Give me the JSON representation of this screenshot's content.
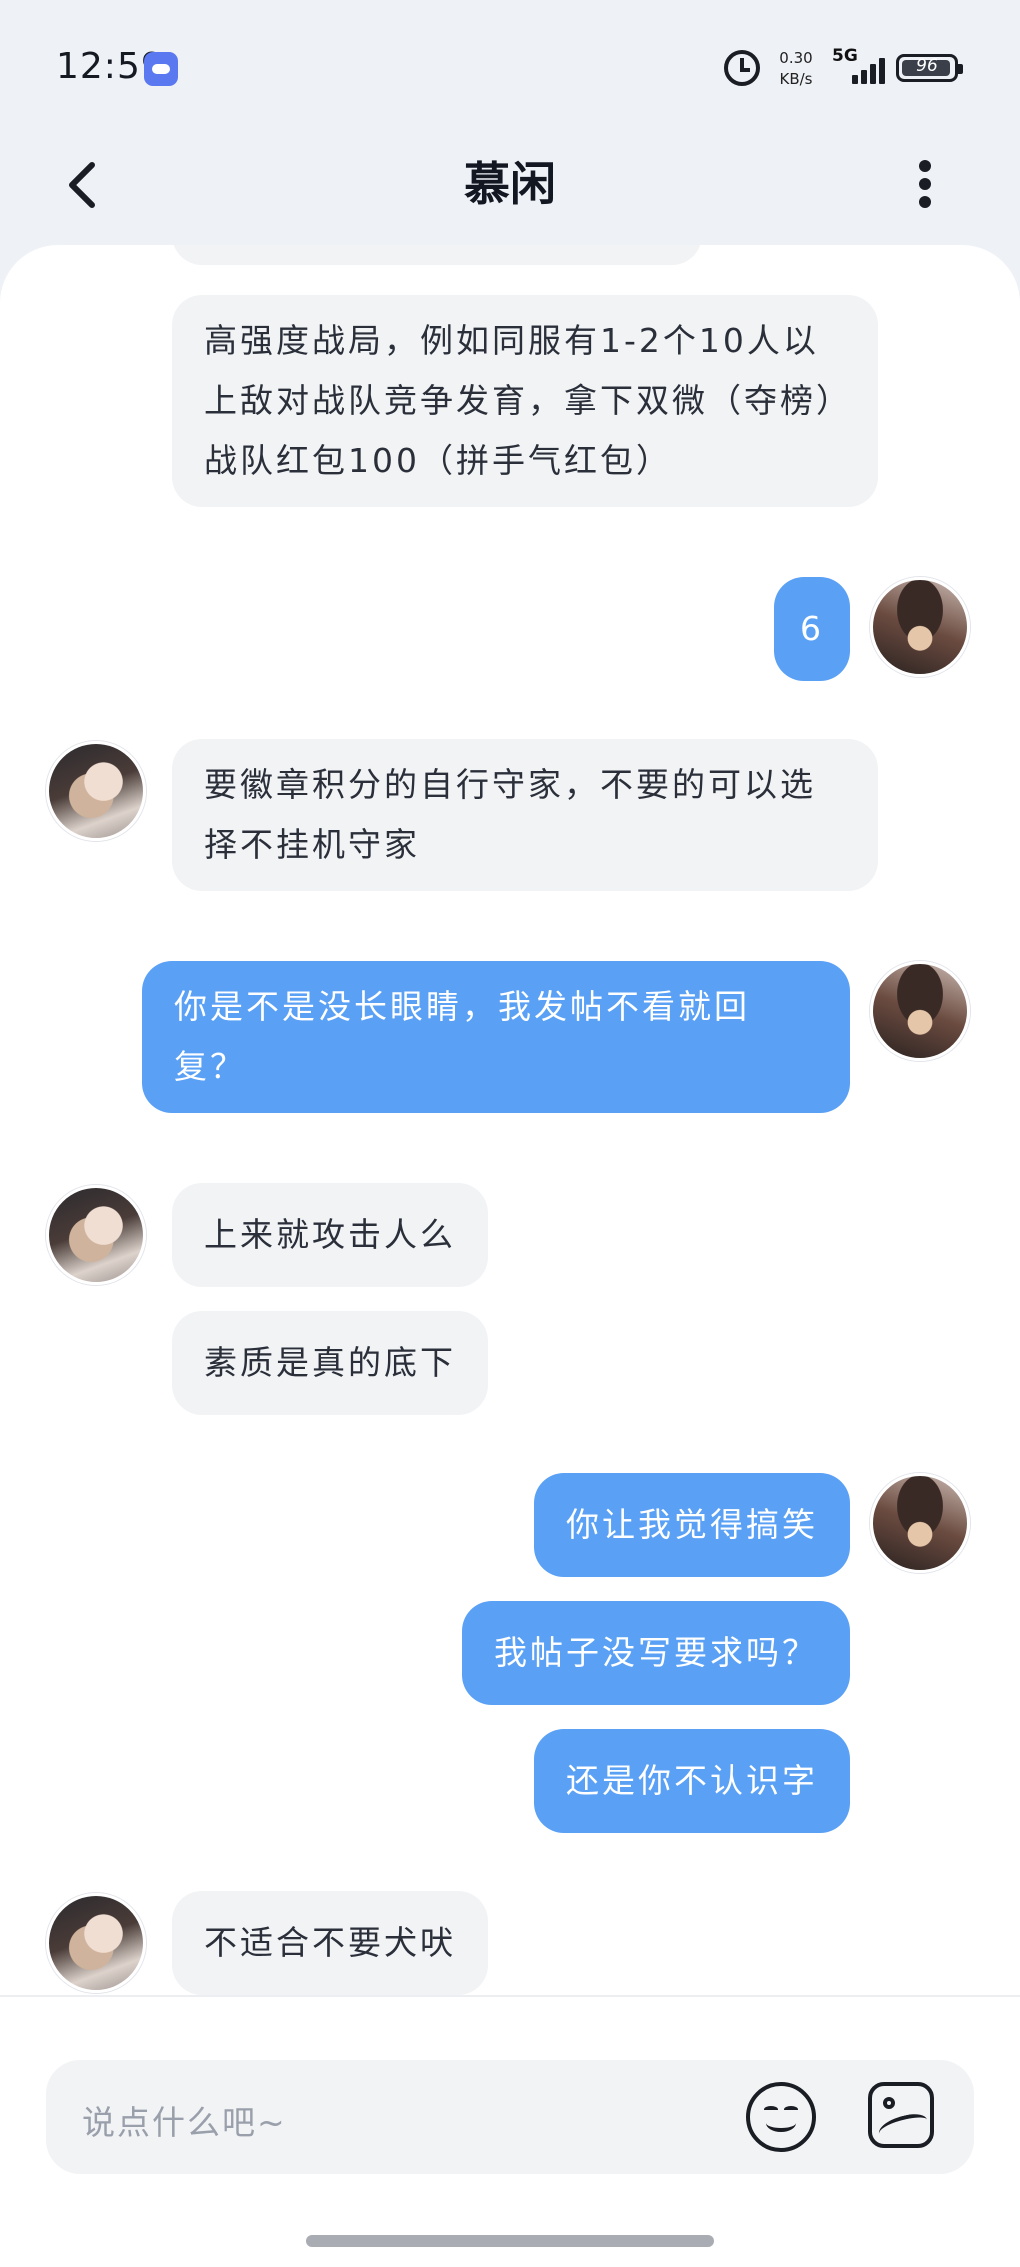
{
  "status_bar": {
    "time": "12:59",
    "net_speed": "0.30",
    "net_unit": "KB/s",
    "net_type": "5G",
    "battery": "96",
    "battery_level": 0.96
  },
  "header": {
    "title": "慕闲"
  },
  "messages": [
    {
      "from": "other",
      "text": "高强度战局，例如同服有1-2个10人以上敌对战队竞争发育，拿下双微（夺榜）战队红包100（拼手气红包）"
    },
    {
      "from": "self",
      "text": "6"
    },
    {
      "from": "other",
      "text": "要徽章积分的自行守家，不要的可以选择不挂机守家"
    },
    {
      "from": "self",
      "text": "你是不是没长眼睛，我发帖不看就回复？"
    },
    {
      "from": "other",
      "text": "上来就攻击人么"
    },
    {
      "from": "other",
      "text": "素质是真的底下"
    },
    {
      "from": "self",
      "text": "你让我觉得搞笑"
    },
    {
      "from": "self",
      "text": "我帖子没写要求吗？"
    },
    {
      "from": "self",
      "text": "还是你不认识字"
    },
    {
      "from": "other",
      "text": "不适合不要犬吠"
    }
  ],
  "input": {
    "placeholder": "说点什么吧~"
  },
  "colors": {
    "outgoing_bubble": "#5aa0f5",
    "incoming_bubble": "#f2f3f5",
    "background": "#eef1f6"
  },
  "icons": [
    "back-arrow-icon",
    "more-vertical-icon",
    "emoji-icon",
    "image-icon",
    "alarm-icon",
    "signal-icon",
    "battery-icon"
  ]
}
